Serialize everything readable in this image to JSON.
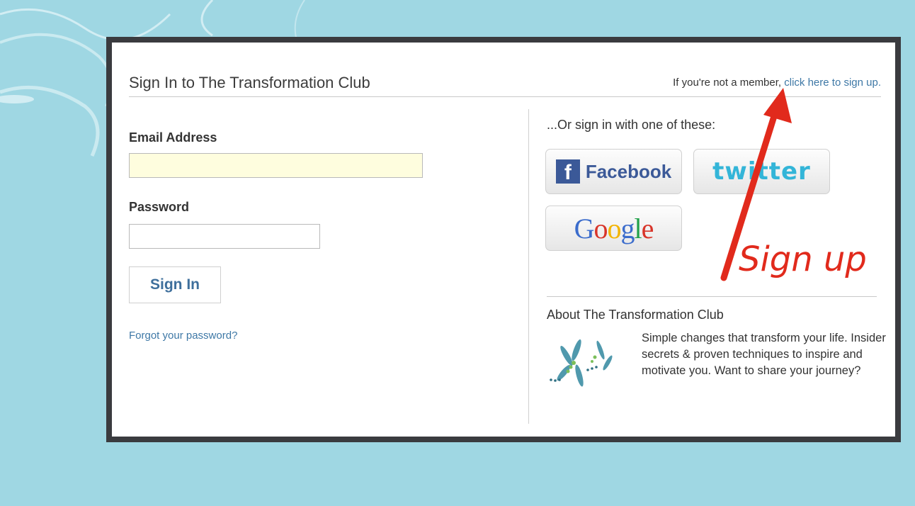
{
  "header": {
    "title": "Sign In to The Transformation Club",
    "member_prefix": "If you're not a member,",
    "signup_link": "click here to sign up."
  },
  "form": {
    "email_label": "Email Address",
    "email_value": "",
    "password_label": "Password",
    "password_value": "",
    "signin_label": "Sign In",
    "forgot_label": "Forgot your password?"
  },
  "social": {
    "heading": "...Or sign in with one of these:",
    "facebook_letter": "f",
    "facebook_label": "Facebook",
    "twitter_label": "twitter",
    "google_label": "Google"
  },
  "about": {
    "title": "About The Transformation Club",
    "text": "Simple changes that transform your life. Insider secrets & proven techniques to inspire and motivate you. Want to share your journey?"
  },
  "annotation": {
    "text": "Sign up",
    "color": "#e12a1c"
  },
  "colors": {
    "background": "#9fd7e3",
    "frame": "#3a3b3f",
    "link": "#3e78a6",
    "facebook": "#3b5998",
    "twitter": "#33b5d8"
  }
}
